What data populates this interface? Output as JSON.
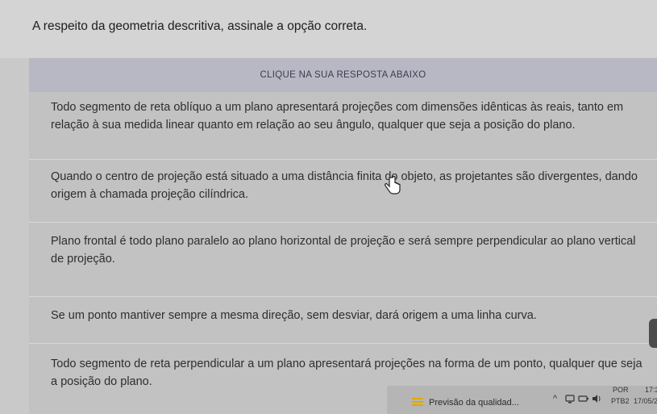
{
  "question": {
    "text": "A respeito da geometria descritiva, assinale a opção correta."
  },
  "instruction": "CLIQUE NA SUA RESPOSTA ABAIXO",
  "options": [
    {
      "text": "Todo segmento de reta oblíquo a um plano apresentará projeções com dimensões idênticas às reais, tanto em relação à sua medida linear quanto em relação ao seu ângulo, qualquer que seja a posição do plano."
    },
    {
      "text": "Quando o centro de projeção está situado a uma distância finita do objeto, as projetantes são divergentes, dando origem à chamada projeção cilíndrica."
    },
    {
      "text": "Plano frontal é todo plano paralelo ao plano horizontal de projeção e será sempre perpendicular ao plano vertical de projeção."
    },
    {
      "text": "Se um ponto mantiver sempre a mesma direção, sem desviar, dará origem a uma linha curva."
    },
    {
      "text": "Todo segmento de reta perpendicular a um plano apresentará projeções na forma de um ponto, qualquer que seja a posição do plano."
    }
  ],
  "taskbar": {
    "weather_text": "Previsão da qualidad...",
    "weather_icon": "weather-icon",
    "lang_top": "POR",
    "lang_bottom": "PTB2",
    "time": "17:3",
    "date": "17/05/2"
  }
}
